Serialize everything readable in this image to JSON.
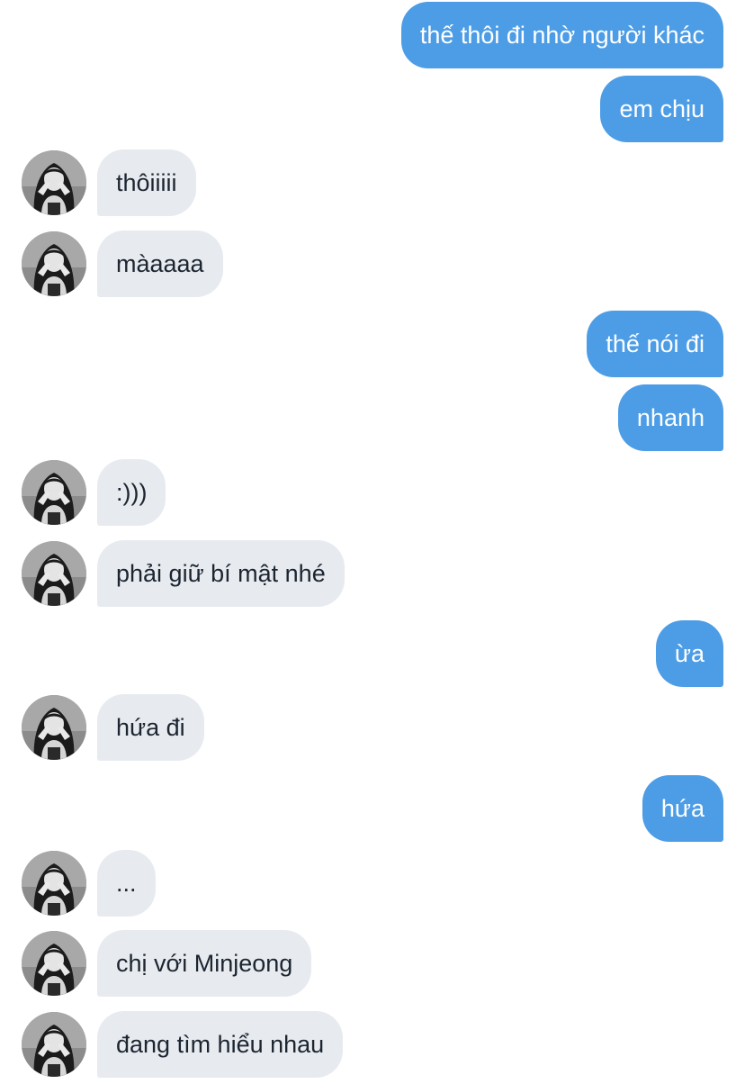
{
  "colors": {
    "outgoing_bubble": "#4d9de6",
    "incoming_bubble": "#e7ebf0",
    "incoming_text": "#1c2530",
    "outgoing_text": "#ffffff"
  },
  "contact": {
    "avatar_icon": "contact-avatar-photo"
  },
  "messages": [
    {
      "from": "me",
      "text": "thế thôi đi nhờ người khác"
    },
    {
      "from": "me",
      "text": "em chịu"
    },
    {
      "from": "contact",
      "text": "thôiiiii"
    },
    {
      "from": "contact",
      "text": "màaaaa"
    },
    {
      "from": "me",
      "text": "thế nói đi"
    },
    {
      "from": "me",
      "text": "nhanh"
    },
    {
      "from": "contact",
      "text": ":)))"
    },
    {
      "from": "contact",
      "text": "phải giữ bí mật nhé"
    },
    {
      "from": "me",
      "text": "ừa"
    },
    {
      "from": "contact",
      "text": "hứa đi"
    },
    {
      "from": "me",
      "text": "hứa"
    },
    {
      "from": "contact",
      "text": "..."
    },
    {
      "from": "contact",
      "text": "chị với Minjeong"
    },
    {
      "from": "contact",
      "text": "đang tìm hiểu nhau"
    }
  ]
}
